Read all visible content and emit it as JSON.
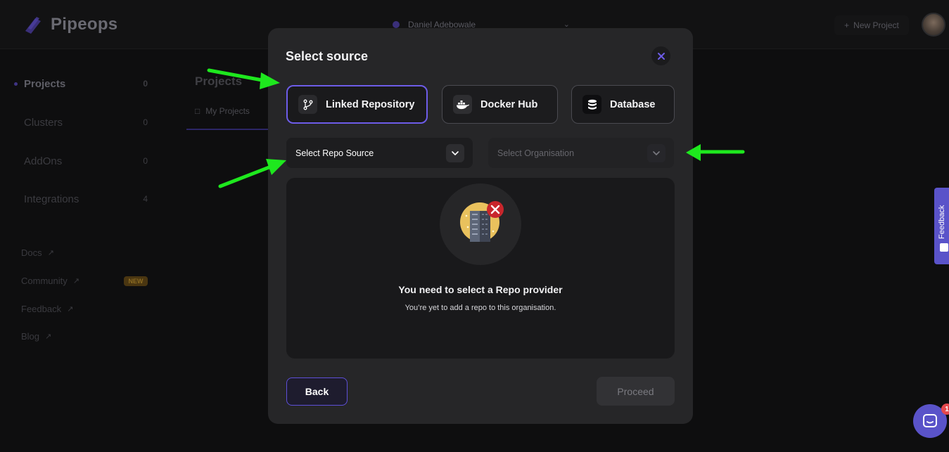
{
  "app": {
    "name": "Pipeops",
    "org_name": "Daniel Adebowale",
    "new_project_label": "New Project",
    "feedback_tab_label": "Feedback",
    "chat_badge_count": "1"
  },
  "sidebar": {
    "items": [
      {
        "label": "Projects",
        "count": "0"
      },
      {
        "label": "Clusters",
        "count": "0"
      },
      {
        "label": "AddOns",
        "count": "0"
      },
      {
        "label": "Integrations",
        "count": "4"
      }
    ],
    "links": [
      {
        "label": "Docs"
      },
      {
        "label": "Community"
      },
      {
        "label": "Feedback"
      },
      {
        "label": "Blog"
      }
    ],
    "new_badge": "NEW"
  },
  "content": {
    "title": "Projects",
    "tab_label": "My Projects"
  },
  "modal": {
    "title": "Select source",
    "source_tabs": [
      {
        "label": "Linked Repository",
        "icon": "git-branch-icon",
        "active": true
      },
      {
        "label": "Docker Hub",
        "icon": "docker-whale-icon",
        "active": false
      },
      {
        "label": "Database",
        "icon": "database-icon",
        "active": false
      }
    ],
    "repo_source": {
      "placeholder": "Select Repo Source"
    },
    "organisation": {
      "placeholder": "Select Organisation"
    },
    "empty_state": {
      "icon": "server-error-icon",
      "title": "You need to select a Repo provider",
      "subtitle": "You’re yet to add a repo to this organisation."
    },
    "back_label": "Back",
    "proceed_label": "Proceed"
  },
  "colors": {
    "accent": "#6d5ce8",
    "annotation_arrow": "#1ee81e",
    "modal_bg": "#262628"
  }
}
